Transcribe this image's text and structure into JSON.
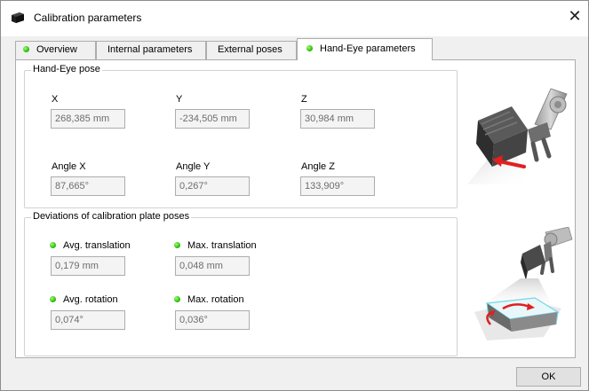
{
  "window": {
    "title": "Calibration parameters",
    "close_glyph": "✕"
  },
  "tabs": [
    {
      "label": "Overview",
      "status": "ok",
      "active": false
    },
    {
      "label": "Internal parameters",
      "active": false
    },
    {
      "label": "External poses",
      "active": false
    },
    {
      "label": "Hand-Eye parameters",
      "status": "ok",
      "active": true
    }
  ],
  "hand_eye_pose": {
    "title": "Hand-Eye pose",
    "fields": [
      {
        "label": "X",
        "value": "268,385 mm"
      },
      {
        "label": "Y",
        "value": "-234,505 mm"
      },
      {
        "label": "Z",
        "value": "30,984 mm"
      },
      {
        "label": "Angle X",
        "value": "87,665°"
      },
      {
        "label": "Angle Y",
        "value": "0,267°"
      },
      {
        "label": "Angle Z",
        "value": "133,909°"
      }
    ]
  },
  "deviations": {
    "title": "Deviations of calibration plate poses",
    "fields": [
      {
        "label": "Avg. translation",
        "value": "0,179 mm",
        "status": "ok"
      },
      {
        "label": "Max. translation",
        "value": "0,048 mm",
        "status": "ok"
      },
      {
        "label": "Avg. rotation",
        "value": "0,074°",
        "status": "ok"
      },
      {
        "label": "Max. rotation",
        "value": "0,036°",
        "status": "ok"
      }
    ]
  },
  "buttons": {
    "ok": "OK"
  },
  "colors": {
    "status_ok": "#2fbf10",
    "arrow": "#e02020",
    "plate_edge": "#6fd8e8"
  },
  "icons": {
    "app": "camera-icon",
    "close": "close-icon"
  }
}
